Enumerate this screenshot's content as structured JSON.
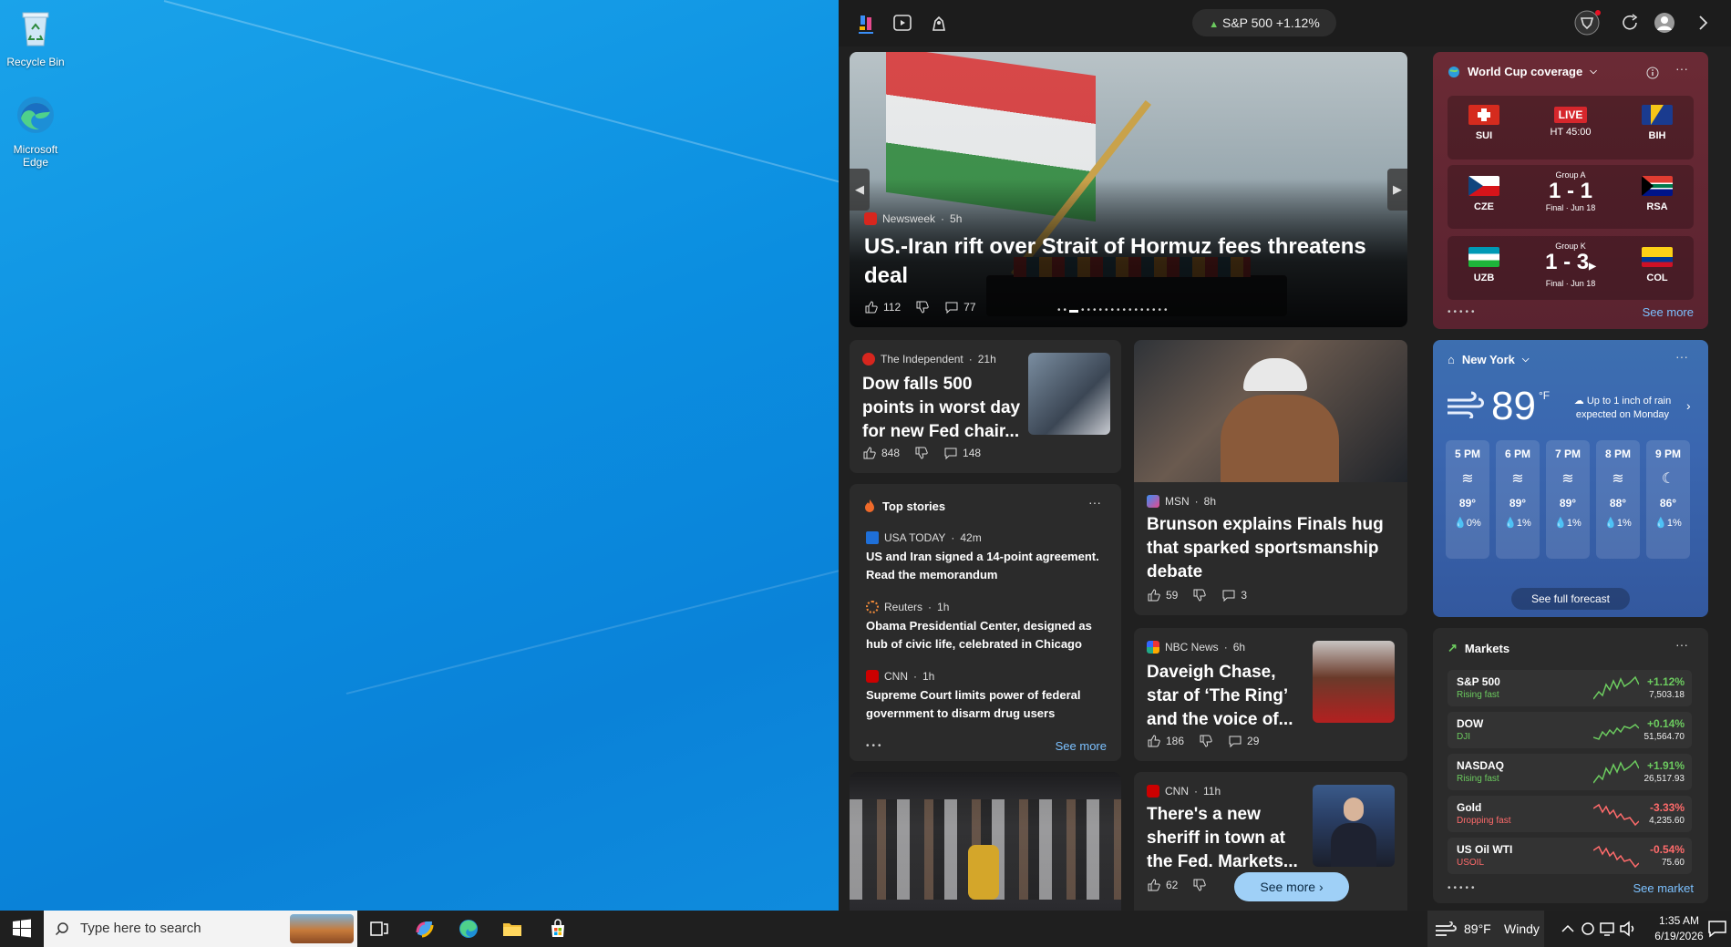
{
  "desktop": {
    "icons": [
      {
        "label": "Recycle Bin"
      },
      {
        "label": "Microsoft Edge"
      }
    ]
  },
  "topbar": {
    "ticker_name": "S&P 500",
    "ticker_change": "+1.12%"
  },
  "hero": {
    "source": "Newsweek",
    "age": "5h",
    "title": "US.-Iran rift over Strait of Hormuz fees threatens deal",
    "likes": "112",
    "comments": "77"
  },
  "worldcup": {
    "title": "World Cup coverage",
    "matches": [
      {
        "home": "SUI",
        "away": "BIH",
        "status": "LIVE",
        "detail": "HT 45:00",
        "group": ""
      },
      {
        "home": "CZE",
        "away": "RSA",
        "score": "1 - 1",
        "detail": "Final · Jun 18",
        "group": "Group A"
      },
      {
        "home": "UZB",
        "away": "COL",
        "score": "1 - 3",
        "detail": "Final · Jun 18",
        "group": "Group K"
      }
    ],
    "see_more": "See more"
  },
  "story_dow": {
    "source": "The Independent",
    "age": "21h",
    "title": "Dow falls 500 points in worst day for new Fed chair...",
    "likes": "848",
    "comments": "148"
  },
  "story_brunson": {
    "source": "MSN",
    "age": "8h",
    "title": "Brunson explains Finals hug that sparked sportsmanship debate",
    "likes": "59",
    "comments": "3"
  },
  "top_stories": {
    "title": "Top stories",
    "items": [
      {
        "source": "USA TODAY",
        "age": "42m",
        "title": "US and Iran signed a 14-point agreement. Read the memorandum"
      },
      {
        "source": "Reuters",
        "age": "1h",
        "title": "Obama Presidential Center, designed as hub of civic life, celebrated in Chicago"
      },
      {
        "source": "CNN",
        "age": "1h",
        "title": "Supreme Court limits power of federal government to disarm drug users"
      }
    ],
    "see_more": "See more"
  },
  "story_daveigh": {
    "source": "NBC News",
    "age": "6h",
    "title": "Daveigh Chase, star of ‘The Ring’ and the voice of...",
    "likes": "186",
    "comments": "29"
  },
  "story_sheriff": {
    "source": "CNN",
    "age": "11h",
    "title": "There's a new sheriff in town at the Fed. Markets...",
    "likes": "62",
    "see_more": "See more"
  },
  "weather": {
    "location": "New York",
    "temp": "89",
    "unit": "°F",
    "note": "Up to 1 inch of rain expected on Monday",
    "hours": [
      {
        "time": "5 PM",
        "temp": "89°",
        "precip": "0%"
      },
      {
        "time": "6 PM",
        "temp": "89°",
        "precip": "1%"
      },
      {
        "time": "7 PM",
        "temp": "89°",
        "precip": "1%"
      },
      {
        "time": "8 PM",
        "temp": "88°",
        "precip": "1%"
      },
      {
        "time": "9 PM",
        "temp": "86°",
        "precip": "1%"
      }
    ],
    "forecast_button": "See full forecast"
  },
  "markets": {
    "title": "Markets",
    "rows": [
      {
        "name": "S&P 500",
        "sub": "Rising fast",
        "pct": "+1.12%",
        "value": "7,503.18",
        "up": true
      },
      {
        "name": "DOW",
        "sub": "DJI",
        "pct": "+0.14%",
        "value": "51,564.70",
        "up": true
      },
      {
        "name": "NASDAQ",
        "sub": "Rising fast",
        "pct": "+1.91%",
        "value": "26,517.93",
        "up": true
      },
      {
        "name": "Gold",
        "sub": "Dropping fast",
        "pct": "-3.33%",
        "value": "4,235.60",
        "up": false
      },
      {
        "name": "US Oil WTI",
        "sub": "USOIL",
        "pct": "-0.54%",
        "value": "75.60",
        "up": false
      }
    ],
    "see_market": "See market"
  },
  "taskbar": {
    "search_placeholder": "Type here to search",
    "weather": "89°F",
    "weather_desc": "Windy",
    "time": "1:35 AM",
    "date": "6/19/2026"
  },
  "colors": {
    "up": "#6ccb5f",
    "down": "#ff6b6b",
    "link": "#7cc1ff"
  }
}
